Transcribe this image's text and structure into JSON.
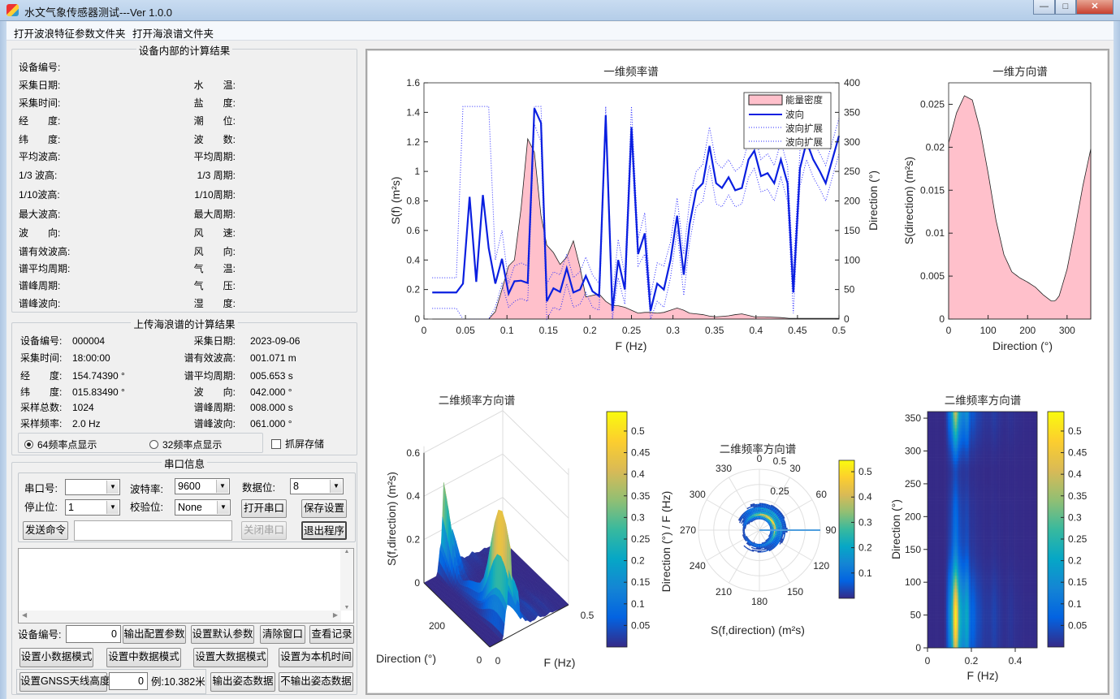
{
  "window": {
    "title": "水文气象传感器测试---Ver 1.0.0",
    "minimize": "—",
    "maximize": "□",
    "close": "✕"
  },
  "menu": [
    "打开波浪特征参数文件夹",
    "打开海浪谱文件夹"
  ],
  "device_results": {
    "title": "设备内部的计算结果",
    "left_labels": [
      "设备编号:",
      "采集日期:",
      "采集时间:",
      "经　　度:",
      "纬　　度:",
      "平均波高:",
      "1/3 波高:",
      "1/10波高:",
      "最大波高:",
      "波　　向:",
      "谱有效波高:",
      "谱平均周期:",
      "谱峰周期:",
      "谱峰波向:"
    ],
    "right_labels": [
      "水　　温:",
      "盐　　度:",
      "潮　　位:",
      "波　　数:",
      "平均周期:",
      "1/3 周期:",
      "1/10周期:",
      "最大周期:",
      "风　　速:",
      "风　　向:",
      "气　　温:",
      "气　　压:",
      "湿　　度:"
    ]
  },
  "upload_results": {
    "title": "上传海浪谱的计算结果",
    "rows": [
      {
        "label": "设备编号:",
        "value": "000004",
        "label2": "采集日期:",
        "value2": "2023-09-06"
      },
      {
        "label": "采集时间:",
        "value": "18:00:00",
        "label2": "谱有效波高:",
        "value2": "001.071 m"
      },
      {
        "label": "经　　度:",
        "value": "154.74390 °",
        "label2": "谱平均周期:",
        "value2": "005.653 s"
      },
      {
        "label": "纬　　度:",
        "value": "015.83490 °",
        "label2": "波　　向:",
        "value2": "042.000 °"
      },
      {
        "label": "采样总数:",
        "value": "1024",
        "label2": "谱峰周期:",
        "value2": "008.000 s"
      },
      {
        "label": "采样频率:",
        "value": "2.0 Hz",
        "label2": "谱峰波向:",
        "value2": "061.000 °"
      }
    ],
    "radio_64": "64频率点显示",
    "radio_32": "32频率点显示",
    "radio_selected": "64",
    "screenshot_checkbox": "抓屏存储",
    "screenshot_checked": false
  },
  "serial": {
    "title": "串口信息",
    "port_label": "串口号:",
    "port_value": "",
    "baud_label": "波特率:",
    "baud_value": "9600",
    "databits_label": "数据位:",
    "databits_value": "8",
    "stopbits_label": "停止位:",
    "stopbits_value": "1",
    "parity_label": "校验位:",
    "parity_value": "None",
    "open_port": "打开串口",
    "save_settings": "保存设置",
    "send_command": "发送命令",
    "command_value": "",
    "close_port": "关闭串口",
    "exit": "退出程序",
    "log_text": "",
    "device_id_label": "设备编号:",
    "device_id_value": "0",
    "output_config": "输出配置参数",
    "set_default": "设置默认参数",
    "clear_window": "清除窗口",
    "view_log": "查看记录",
    "small_mode": "设置小数据模式",
    "medium_mode": "设置中数据模式",
    "large_mode": "设置大数据模式",
    "set_local_time": "设置为本机时间",
    "gnss_height": "设置GNSS天线高度",
    "gnss_value": "0",
    "gnss_example": "例:10.382米",
    "output_attitude": "输出姿态数据",
    "no_output_attitude": "不输出姿态数据"
  },
  "colors": {
    "energy_fill": "#ffc0cb",
    "direction_line": "#0a1fe0",
    "spread_line": "#2a2aff"
  },
  "colormap": [
    "#352a87",
    "#0363e1",
    "#1485d4",
    "#06a7c6",
    "#38b99e",
    "#92bf73",
    "#d9ba56",
    "#fcce2e",
    "#f9fb0e"
  ],
  "chart_data": [
    {
      "type": "area+line",
      "title": "一维频率谱",
      "xlabel": "F (Hz)",
      "ylabel": "S(f) (m²s)",
      "ylabel_right": "Direction (°)",
      "xlim": [
        0,
        0.5
      ],
      "ylim": [
        0,
        1.6
      ],
      "ylim_right": [
        0,
        400
      ],
      "x_ticks": [
        0,
        0.05,
        0.1,
        0.15,
        0.2,
        0.25,
        0.3,
        0.35,
        0.4,
        0.45,
        0.5
      ],
      "y_ticks": [
        0,
        0.2,
        0.4,
        0.6,
        0.8,
        1,
        1.2,
        1.4,
        1.6
      ],
      "y_ticks_right": [
        0,
        50,
        100,
        150,
        200,
        250,
        300,
        350,
        400
      ],
      "legend": [
        "能量密度",
        "波向",
        "波向扩展",
        "波向扩展"
      ],
      "legend_placement": "top-right",
      "energy": {
        "f": [
          0.01,
          0.078,
          0.086,
          0.094,
          0.102,
          0.109,
          0.117,
          0.125,
          0.133,
          0.141,
          0.148,
          0.156,
          0.164,
          0.172,
          0.18,
          0.188,
          0.195,
          0.203,
          0.211,
          0.219,
          0.227,
          0.234,
          0.242,
          0.25,
          0.258,
          0.266,
          0.273,
          0.281,
          0.289,
          0.297,
          0.305,
          0.313,
          0.32,
          0.328,
          0.336,
          0.344,
          0.352,
          0.359,
          0.367,
          0.375,
          0.383,
          0.391,
          0.398,
          0.41,
          0.43,
          0.44,
          0.5
        ],
        "values": [
          0,
          0,
          0.05,
          0.2,
          0.36,
          0.4,
          0.75,
          1.22,
          1.13,
          0.7,
          0.5,
          0.45,
          0.37,
          0.42,
          0.53,
          0.35,
          0.15,
          0.16,
          0.17,
          0.12,
          0.09,
          0.09,
          0.08,
          0.06,
          0.04,
          0.045,
          0.045,
          0.04,
          0.045,
          0.06,
          0.075,
          0.06,
          0.04,
          0.035,
          0.03,
          0.02,
          0.015,
          0.018,
          0.022,
          0.03,
          0.035,
          0.025,
          0.015,
          0.015,
          0.01,
          0.005,
          0.005
        ]
      },
      "direction": {
        "f": [
          0.01,
          0.039,
          0.047,
          0.055,
          0.063,
          0.071,
          0.078,
          0.086,
          0.094,
          0.102,
          0.109,
          0.117,
          0.125,
          0.133,
          0.141,
          0.148,
          0.156,
          0.164,
          0.172,
          0.18,
          0.188,
          0.195,
          0.203,
          0.211,
          0.219,
          0.227,
          0.234,
          0.242,
          0.25,
          0.258,
          0.266,
          0.273,
          0.281,
          0.289,
          0.297,
          0.305,
          0.313,
          0.32,
          0.328,
          0.336,
          0.344,
          0.352,
          0.359,
          0.367,
          0.375,
          0.383,
          0.391,
          0.398,
          0.406,
          0.414,
          0.422,
          0.43,
          0.438,
          0.445,
          0.453,
          0.461,
          0.469,
          0.477,
          0.484,
          0.5
        ],
        "values": [
          45,
          45,
          60,
          207,
          63,
          210,
          120,
          60,
          102,
          43,
          64,
          65,
          61,
          357,
          332,
          30,
          52,
          46,
          86,
          45,
          50,
          73,
          47,
          39,
          345,
          14,
          100,
          50,
          325,
          110,
          145,
          14,
          60,
          50,
          100,
          175,
          75,
          160,
          218,
          230,
          293,
          230,
          222,
          240,
          218,
          222,
          270,
          285,
          242,
          247,
          230,
          270,
          230,
          45,
          255,
          300,
          270,
          250,
          230,
          310
        ],
        "spread_upper": [
          70,
          70,
          360,
          360,
          360,
          360,
          360,
          100,
          150,
          60,
          90,
          95,
          90,
          360,
          360,
          60,
          80,
          75,
          110,
          70,
          80,
          105,
          75,
          60,
          360,
          40,
          135,
          75,
          360,
          135,
          180,
          40,
          95,
          90,
          130,
          205,
          110,
          200,
          250,
          262,
          325,
          265,
          255,
          270,
          250,
          260,
          300,
          315,
          270,
          280,
          260,
          300,
          260,
          80,
          285,
          330,
          300,
          280,
          260,
          340
        ],
        "spread_lower": [
          18,
          18,
          0,
          0,
          0,
          0,
          0,
          20,
          60,
          20,
          30,
          35,
          30,
          330,
          300,
          0,
          20,
          15,
          60,
          20,
          25,
          45,
          20,
          15,
          330,
          0,
          70,
          25,
          295,
          90,
          110,
          0,
          30,
          20,
          70,
          150,
          40,
          130,
          190,
          200,
          260,
          195,
          190,
          210,
          190,
          195,
          240,
          255,
          215,
          220,
          200,
          240,
          200,
          10,
          225,
          270,
          240,
          220,
          200,
          280
        ]
      }
    },
    {
      "type": "area",
      "title": "一维方向谱",
      "xlabel": "Direction (°)",
      "ylabel": "S(direction) (m²s)",
      "xlim": [
        0,
        360
      ],
      "ylim": [
        0,
        0.0275
      ],
      "x_ticks": [
        0,
        100,
        200,
        300
      ],
      "y_ticks": [
        0,
        0.005,
        0.01,
        0.015,
        0.02,
        0.025
      ],
      "direction": [
        0,
        20,
        40,
        60,
        80,
        100,
        120,
        140,
        160,
        180,
        200,
        220,
        240,
        260,
        270,
        280,
        300,
        320,
        340,
        360
      ],
      "values": [
        0.0205,
        0.024,
        0.026,
        0.0255,
        0.022,
        0.017,
        0.0115,
        0.0075,
        0.0055,
        0.0048,
        0.0043,
        0.0037,
        0.0028,
        0.0021,
        0.0021,
        0.0027,
        0.0058,
        0.0105,
        0.0155,
        0.0198
      ]
    },
    {
      "type": "surface",
      "title": "二维频率方向谱",
      "xlabel": "F (Hz)",
      "ylabel": "Direction (°)",
      "zlabel": "S(f,direction) (m²s)",
      "f_ticks": [
        0,
        0.5
      ],
      "direction_ticks": [
        0,
        200
      ],
      "z_ticks": [
        0,
        0.2,
        0.4,
        0.6
      ],
      "zlim": [
        0,
        0.6
      ],
      "clim": [
        0,
        0.545
      ],
      "colorbar_ticks": [
        0.05,
        0.1,
        0.15,
        0.2,
        0.25,
        0.3,
        0.35,
        0.4,
        0.45,
        0.5
      ]
    },
    {
      "type": "polar",
      "title": "二维频率方向谱",
      "angle_ticks": [
        0,
        30,
        60,
        90,
        120,
        150,
        180,
        210,
        240,
        270,
        300,
        330
      ],
      "radius_ticks": [
        0.25,
        0.5
      ],
      "ylabel": "Direction (°) / F (Hz)",
      "xlabel": "S(f,direction) (m²s)",
      "clim": [
        0,
        0.545
      ],
      "colorbar_ticks": [
        0.1,
        0.2,
        0.3,
        0.4,
        0.5
      ]
    },
    {
      "type": "heatmap",
      "title": "二维频率方向谱",
      "xlabel": "F (Hz)",
      "ylabel": "Direction (°)",
      "xlim": [
        0,
        0.5
      ],
      "ylim": [
        0,
        360
      ],
      "x_ticks": [
        0,
        0.2,
        0.4
      ],
      "y_ticks": [
        0,
        50,
        100,
        150,
        200,
        250,
        300,
        350
      ],
      "clim": [
        0,
        0.545
      ],
      "colorbar_ticks": [
        0.05,
        0.1,
        0.15,
        0.2,
        0.25,
        0.3,
        0.35,
        0.4,
        0.45,
        0.5
      ]
    }
  ]
}
